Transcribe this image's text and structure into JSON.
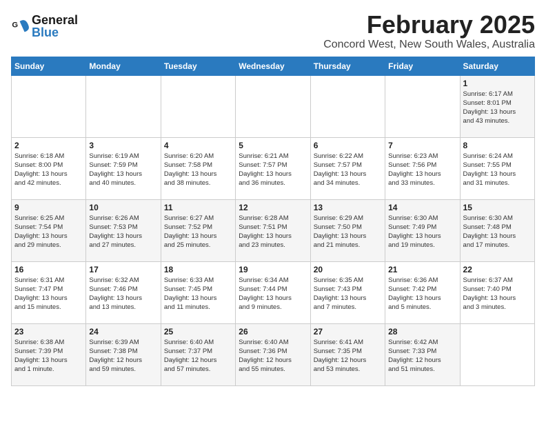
{
  "header": {
    "logo_line1": "General",
    "logo_line2": "Blue",
    "title": "February 2025",
    "subtitle": "Concord West, New South Wales, Australia"
  },
  "weekdays": [
    "Sunday",
    "Monday",
    "Tuesday",
    "Wednesday",
    "Thursday",
    "Friday",
    "Saturday"
  ],
  "weeks": [
    [
      {
        "day": "",
        "info": ""
      },
      {
        "day": "",
        "info": ""
      },
      {
        "day": "",
        "info": ""
      },
      {
        "day": "",
        "info": ""
      },
      {
        "day": "",
        "info": ""
      },
      {
        "day": "",
        "info": ""
      },
      {
        "day": "1",
        "info": "Sunrise: 6:17 AM\nSunset: 8:01 PM\nDaylight: 13 hours\nand 43 minutes."
      }
    ],
    [
      {
        "day": "2",
        "info": "Sunrise: 6:18 AM\nSunset: 8:00 PM\nDaylight: 13 hours\nand 42 minutes."
      },
      {
        "day": "3",
        "info": "Sunrise: 6:19 AM\nSunset: 7:59 PM\nDaylight: 13 hours\nand 40 minutes."
      },
      {
        "day": "4",
        "info": "Sunrise: 6:20 AM\nSunset: 7:58 PM\nDaylight: 13 hours\nand 38 minutes."
      },
      {
        "day": "5",
        "info": "Sunrise: 6:21 AM\nSunset: 7:57 PM\nDaylight: 13 hours\nand 36 minutes."
      },
      {
        "day": "6",
        "info": "Sunrise: 6:22 AM\nSunset: 7:57 PM\nDaylight: 13 hours\nand 34 minutes."
      },
      {
        "day": "7",
        "info": "Sunrise: 6:23 AM\nSunset: 7:56 PM\nDaylight: 13 hours\nand 33 minutes."
      },
      {
        "day": "8",
        "info": "Sunrise: 6:24 AM\nSunset: 7:55 PM\nDaylight: 13 hours\nand 31 minutes."
      }
    ],
    [
      {
        "day": "9",
        "info": "Sunrise: 6:25 AM\nSunset: 7:54 PM\nDaylight: 13 hours\nand 29 minutes."
      },
      {
        "day": "10",
        "info": "Sunrise: 6:26 AM\nSunset: 7:53 PM\nDaylight: 13 hours\nand 27 minutes."
      },
      {
        "day": "11",
        "info": "Sunrise: 6:27 AM\nSunset: 7:52 PM\nDaylight: 13 hours\nand 25 minutes."
      },
      {
        "day": "12",
        "info": "Sunrise: 6:28 AM\nSunset: 7:51 PM\nDaylight: 13 hours\nand 23 minutes."
      },
      {
        "day": "13",
        "info": "Sunrise: 6:29 AM\nSunset: 7:50 PM\nDaylight: 13 hours\nand 21 minutes."
      },
      {
        "day": "14",
        "info": "Sunrise: 6:30 AM\nSunset: 7:49 PM\nDaylight: 13 hours\nand 19 minutes."
      },
      {
        "day": "15",
        "info": "Sunrise: 6:30 AM\nSunset: 7:48 PM\nDaylight: 13 hours\nand 17 minutes."
      }
    ],
    [
      {
        "day": "16",
        "info": "Sunrise: 6:31 AM\nSunset: 7:47 PM\nDaylight: 13 hours\nand 15 minutes."
      },
      {
        "day": "17",
        "info": "Sunrise: 6:32 AM\nSunset: 7:46 PM\nDaylight: 13 hours\nand 13 minutes."
      },
      {
        "day": "18",
        "info": "Sunrise: 6:33 AM\nSunset: 7:45 PM\nDaylight: 13 hours\nand 11 minutes."
      },
      {
        "day": "19",
        "info": "Sunrise: 6:34 AM\nSunset: 7:44 PM\nDaylight: 13 hours\nand 9 minutes."
      },
      {
        "day": "20",
        "info": "Sunrise: 6:35 AM\nSunset: 7:43 PM\nDaylight: 13 hours\nand 7 minutes."
      },
      {
        "day": "21",
        "info": "Sunrise: 6:36 AM\nSunset: 7:42 PM\nDaylight: 13 hours\nand 5 minutes."
      },
      {
        "day": "22",
        "info": "Sunrise: 6:37 AM\nSunset: 7:40 PM\nDaylight: 13 hours\nand 3 minutes."
      }
    ],
    [
      {
        "day": "23",
        "info": "Sunrise: 6:38 AM\nSunset: 7:39 PM\nDaylight: 13 hours\nand 1 minute."
      },
      {
        "day": "24",
        "info": "Sunrise: 6:39 AM\nSunset: 7:38 PM\nDaylight: 12 hours\nand 59 minutes."
      },
      {
        "day": "25",
        "info": "Sunrise: 6:40 AM\nSunset: 7:37 PM\nDaylight: 12 hours\nand 57 minutes."
      },
      {
        "day": "26",
        "info": "Sunrise: 6:40 AM\nSunset: 7:36 PM\nDaylight: 12 hours\nand 55 minutes."
      },
      {
        "day": "27",
        "info": "Sunrise: 6:41 AM\nSunset: 7:35 PM\nDaylight: 12 hours\nand 53 minutes."
      },
      {
        "day": "28",
        "info": "Sunrise: 6:42 AM\nSunset: 7:33 PM\nDaylight: 12 hours\nand 51 minutes."
      },
      {
        "day": "",
        "info": ""
      }
    ]
  ]
}
